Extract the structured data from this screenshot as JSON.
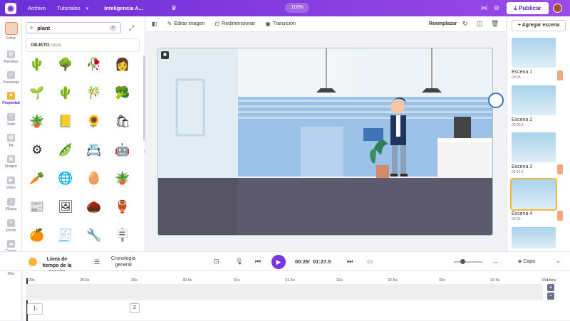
{
  "topbar": {
    "menu": [
      "Archivo",
      "Tutoriales"
    ],
    "project_title": "Inteligencia A...",
    "zoom": "118%",
    "publish_label": "Publicar"
  },
  "leftnav": {
    "items": [
      {
        "label": "Editar"
      },
      {
        "label": "Plantillas"
      },
      {
        "label": "Personaje"
      },
      {
        "label": "Propiedad"
      },
      {
        "label": "Texto"
      },
      {
        "label": "bg"
      },
      {
        "label": "Imagen"
      },
      {
        "label": "Video"
      },
      {
        "label": "Música"
      },
      {
        "label": "Efecto"
      },
      {
        "label": "Cargas"
      },
      {
        "label": "Más"
      }
    ],
    "active": "Propiedad"
  },
  "panel": {
    "search_value": "plant",
    "section_title": "OBJETO",
    "section_count": "(1624)",
    "objects": [
      "🌵",
      "🌳",
      "🥀",
      "👩",
      "🌱",
      "🌵",
      "🎋",
      "🥦",
      "🪴",
      "📒",
      "🌻",
      "🛍",
      "⚙",
      "🫛",
      "📇",
      "🤖",
      "🥕",
      "🌐",
      "🥚",
      "🪴",
      "📰",
      "🖼",
      "🌰",
      "🏺",
      "🍊",
      "🧾",
      "🔧",
      "🪧"
    ]
  },
  "toolbar": {
    "edit_image": "Editar imagen",
    "resize": "Redimensionar",
    "transition": "Transición",
    "replace": "Reemplazar"
  },
  "scenes": {
    "add_label": "+ Agregar escena",
    "items": [
      {
        "name": "Escena 1",
        "duration": "00:05"
      },
      {
        "name": "Escena 2",
        "duration": "00:09.8"
      },
      {
        "name": "Escena 3",
        "duration": "00:14.5"
      },
      {
        "name": "Escena 4",
        "duration": "00:05"
      }
    ],
    "selected": "Escena 4"
  },
  "bottombar": {
    "scene_timeline": "Línea de tiempo de la escena",
    "general_chronology": "Cronología general",
    "time_current": "00:29",
    "time_total": "01:27.5",
    "layer_label": "Capa"
  },
  "timeline": {
    "ruler": [
      "29s",
      "29.5s",
      "30s",
      "30.5s",
      "31s",
      "31.5s",
      "32s",
      "32.5s",
      "33s",
      "33.5s",
      "34s"
    ],
    "zoom_label": "Hora",
    "track_badge": "2"
  },
  "colors": {
    "accent": "#7a35dc",
    "active_nav": "#f5b73b",
    "play_button": "#7a35dc"
  }
}
